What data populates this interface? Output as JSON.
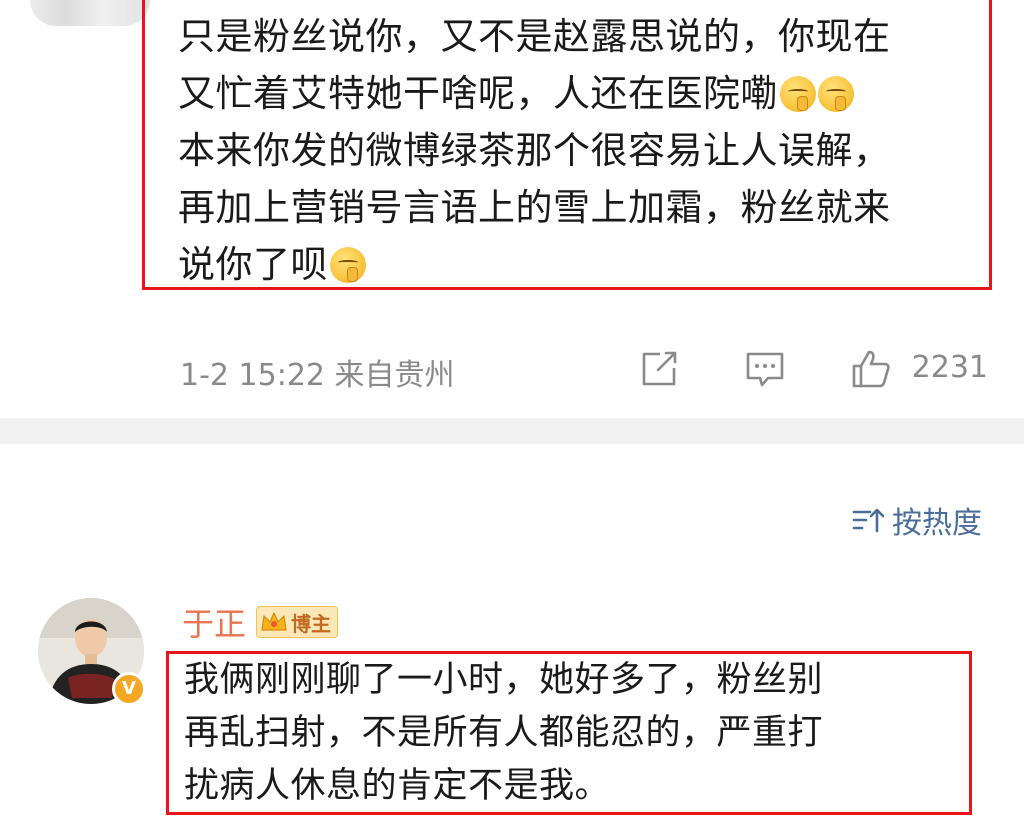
{
  "comment1": {
    "lines": [
      "只是粉丝说你，又不是赵露思说的，你现在",
      "又忙着艾特她干啥呢，人还在医院嘞",
      "本来你发的微博绿茶那个很容易让人误解，",
      "再加上营销号言语上的雪上加霜，粉丝就来",
      "说你了呗"
    ],
    "emoji": "shush-face-emoji",
    "timestamp": "1-2 15:22",
    "location": "来自贵州",
    "like_count": "2231",
    "icons": [
      "share-icon",
      "comment-icon",
      "like-icon"
    ]
  },
  "sort": {
    "label": "按热度",
    "icon": "sort-icon"
  },
  "comment2": {
    "author": "于正",
    "badge_label": "博主",
    "badge_icon": "crown-icon",
    "verified_icon": "verified-v-icon",
    "verified_text": "V",
    "lines": [
      "我俩刚刚聊了一小时，她好多了，粉丝别",
      "再乱扫射，不是所有人都能忍的，严重打",
      "扰病人休息的肯定不是我。"
    ]
  },
  "colors": {
    "highlight": "#e8141a",
    "author": "#eb7350",
    "meta": "#8a8a8a",
    "link": "#4a6e9a"
  }
}
